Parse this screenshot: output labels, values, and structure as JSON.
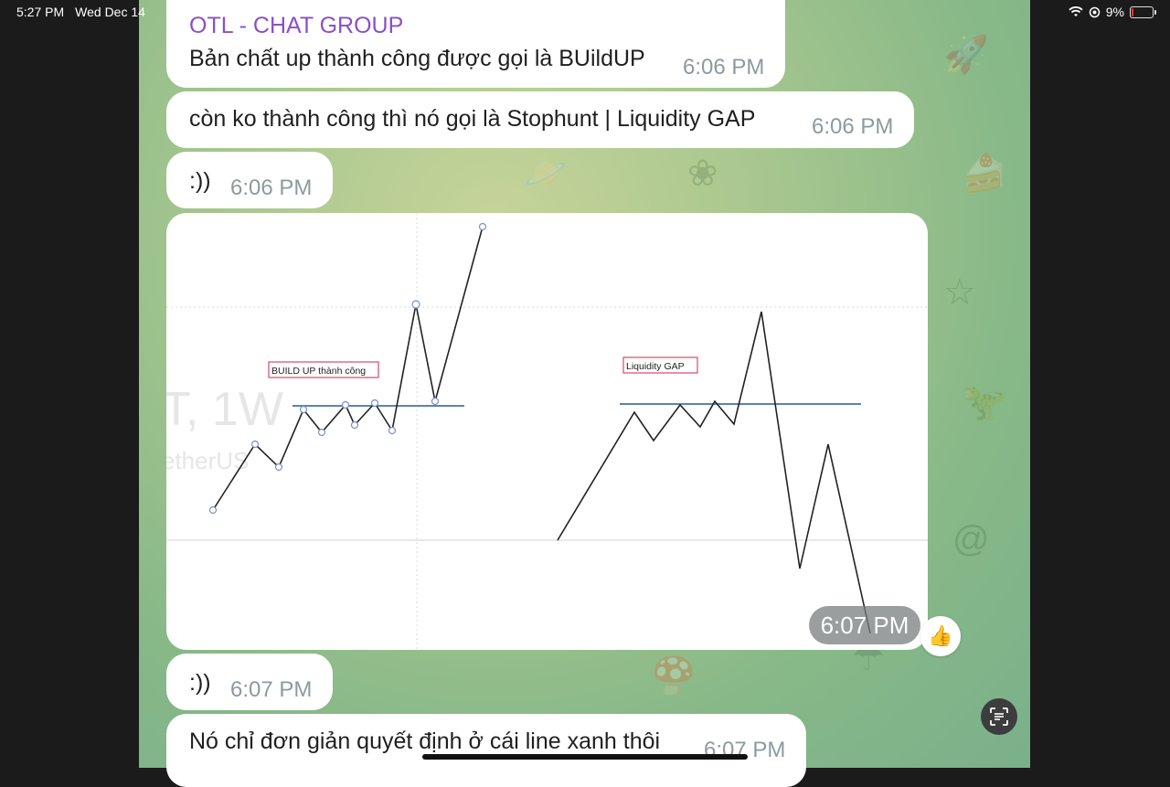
{
  "status_bar": {
    "time": "5:27 PM",
    "date": "Wed Dec 14",
    "battery": "9%",
    "battery_level": 0.09
  },
  "chat": {
    "group_name": "OTL - CHAT GROUP"
  },
  "messages": [
    {
      "text": "Bản chất up thành công được gọi là BUildUP",
      "time": "6:06 PM"
    },
    {
      "text": "còn ko thành công thì nó gọi là Stophunt | Liquidity GAP",
      "time": "6:06 PM"
    },
    {
      "text": ":))",
      "time": "6:06 PM"
    },
    {
      "text": ":))",
      "time": "6:07 PM"
    },
    {
      "text": "Nó chỉ đơn giản quyết định ở cái line xanh thôi",
      "time": "6:07 PM"
    }
  ],
  "photo": {
    "time": "6:07 PM",
    "left_label": "BUILD UP thành công",
    "right_label": "Liquidity GAP",
    "watermark_main": "T, 1W",
    "watermark_sub": "etherUS",
    "reaction": "👍"
  },
  "colors": {
    "sender": "#8b4fc9",
    "level_line": "#5b84b1",
    "label_border": "#d9486a"
  },
  "icons": [
    "wifi-icon",
    "location-icon",
    "battery-icon",
    "thumbs-up-icon",
    "scan-text-icon"
  ]
}
